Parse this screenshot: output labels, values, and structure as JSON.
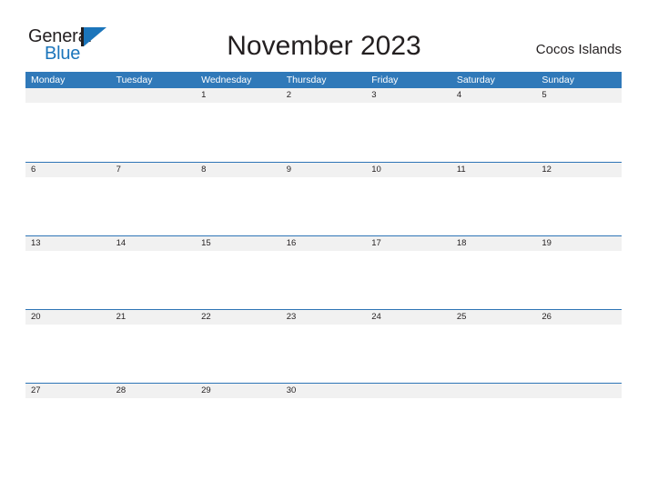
{
  "brand": {
    "name_part1": "General",
    "name_part2": "Blue",
    "flag_icon": "blue-triangle-flag-icon",
    "accent_color": "#1b75bb"
  },
  "header": {
    "title": "November 2023",
    "region": "Cocos Islands"
  },
  "calendar": {
    "header_color": "#3079b9",
    "rule_color": "#2e75b6",
    "daynum_band_color": "#f1f1f1",
    "weekdays": [
      "Monday",
      "Tuesday",
      "Wednesday",
      "Thursday",
      "Friday",
      "Saturday",
      "Sunday"
    ],
    "weeks": [
      [
        "",
        "",
        "1",
        "2",
        "3",
        "4",
        "5"
      ],
      [
        "6",
        "7",
        "8",
        "9",
        "10",
        "11",
        "12"
      ],
      [
        "13",
        "14",
        "15",
        "16",
        "17",
        "18",
        "19"
      ],
      [
        "20",
        "21",
        "22",
        "23",
        "24",
        "25",
        "26"
      ],
      [
        "27",
        "28",
        "29",
        "30",
        "",
        "",
        ""
      ]
    ]
  }
}
